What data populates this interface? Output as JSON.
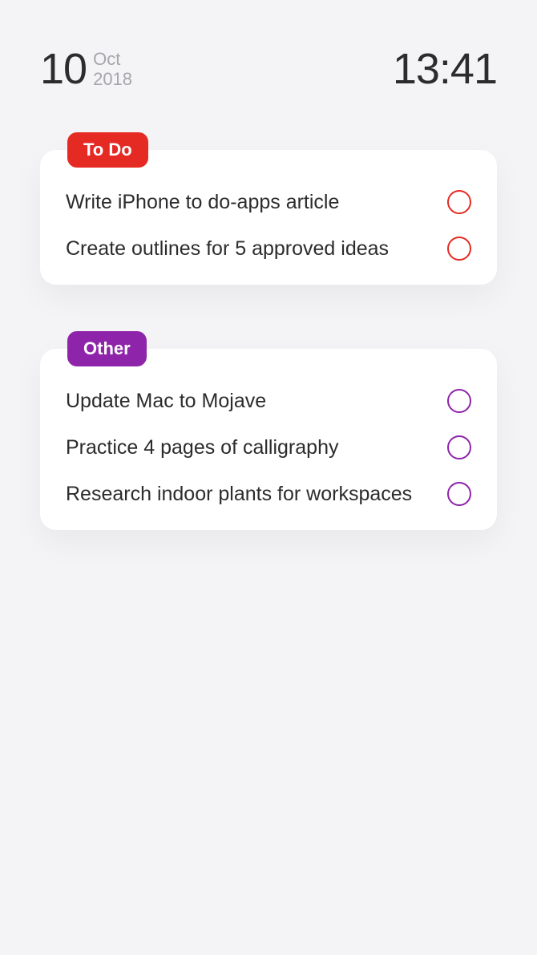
{
  "header": {
    "day": "10",
    "month": "Oct",
    "year": "2018",
    "time": "13:41"
  },
  "lists": [
    {
      "label": "To Do",
      "color": "red",
      "tasks": [
        {
          "text": "Write iPhone to do-apps article"
        },
        {
          "text": "Create outlines for 5 approved ideas"
        }
      ]
    },
    {
      "label": "Other",
      "color": "purple",
      "tasks": [
        {
          "text": "Update Mac to Mojave"
        },
        {
          "text": "Practice 4 pages of calligraphy"
        },
        {
          "text": "Research indoor plants for workspaces"
        }
      ]
    }
  ]
}
